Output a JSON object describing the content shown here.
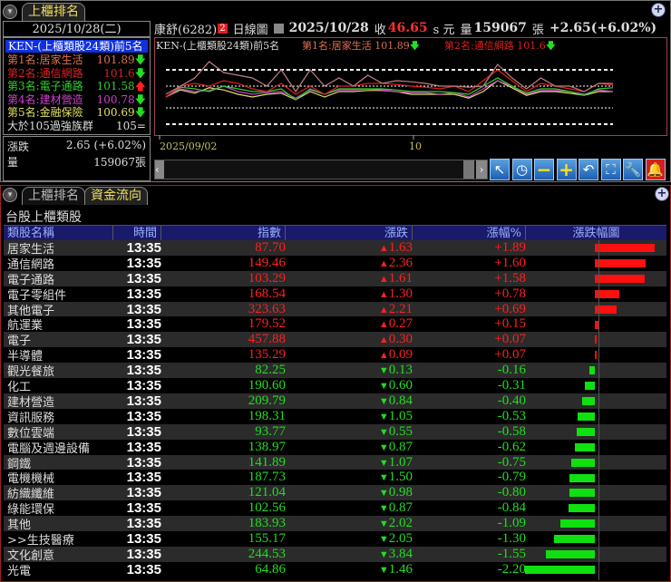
{
  "top": {
    "tab_label": "上櫃排名",
    "date": "2025/10/28(二)",
    "ranking_title": "KEN-(上櫃類股24類)前5名",
    "ranks": [
      {
        "label": "第1名:居家生活",
        "value": "101.89",
        "dir": "down",
        "color": "#e07050"
      },
      {
        "label": "第2名:通信網路",
        "value": "101.6",
        "dir": "down",
        "color": "#e02020"
      },
      {
        "label": "第3名:電子通路",
        "value": "101.58",
        "dir": "up",
        "color": "#30d030"
      },
      {
        "label": "第4名:建材營造",
        "value": "100.78",
        "dir": "down",
        "color": "#d040d0"
      },
      {
        "label": "第5名:金融保險",
        "value": "100.69",
        "dir": "down",
        "color": "#e0e060"
      },
      {
        "label": "大於105過強族群",
        "value": "105=",
        "dir": "",
        "color": "#dddddd"
      }
    ],
    "change_label": "漲跌",
    "change_value": "2.65 (+6.02%)",
    "volume_label": "量",
    "volume_value": "159067張",
    "stock": "康舒(6282)",
    "badge": "2",
    "chart_type": "日線圖",
    "quote_date": "2025/10/28",
    "close_label": "收",
    "close_value": "46.65",
    "close_unit": "s 元",
    "vol_label": "量",
    "vol_value": "159067",
    "vol_unit": "張",
    "chg": "+2.65(+6.02%)",
    "chart_title": "KEN-(上櫃類股24類)前5名",
    "legend1": "第1名:居家生活 101.89",
    "legend2": "第2名:通信網路 101.6",
    "x_start": "2025/09/02",
    "x_mid": "10"
  },
  "chart_data": {
    "type": "line",
    "title": "KEN-(上櫃類股24類)前5名",
    "reference_levels": [
      104,
      101,
      97,
      94
    ],
    "series": [
      {
        "name": "居家生活",
        "color": "#c08080",
        "values": [
          99.5,
          101,
          102.5,
          105.5,
          103.5,
          103,
          102.5,
          101,
          104,
          100,
          104,
          101,
          102.5,
          101,
          103,
          101.5,
          102,
          101.8,
          101.5,
          101,
          101,
          100.8,
          101,
          105,
          102.5,
          100.5,
          102.5,
          101,
          101,
          100,
          101.5,
          101.5
        ]
      },
      {
        "name": "通信網路",
        "color": "#e02020",
        "values": [
          99,
          101,
          101.5,
          101,
          102,
          101.5,
          100.5,
          100,
          101.5,
          99.5,
          101,
          99.5,
          101,
          101,
          101.5,
          101.5,
          101.3,
          101,
          100.8,
          100.5,
          101,
          100,
          102,
          104,
          102,
          100,
          101.5,
          101,
          100.5,
          100,
          101.5,
          101.2
        ]
      },
      {
        "name": "電子通路",
        "color": "#30d030",
        "values": [
          99,
          100.8,
          100.5,
          100,
          101,
          100.5,
          100,
          100,
          100.5,
          98.5,
          100.5,
          99.5,
          100.5,
          100.5,
          100.5,
          100.5,
          100.3,
          100,
          100,
          100,
          99.8,
          99.5,
          101,
          102.5,
          101,
          99.7,
          100.5,
          100.5,
          100,
          99.3,
          100.5,
          100.7
        ]
      },
      {
        "name": "建材營造",
        "color": "#d040d0",
        "values": [
          99,
          100.5,
          100,
          100.2,
          101,
          100,
          99.5,
          99.8,
          100,
          98.8,
          100.3,
          99.5,
          100.3,
          100.3,
          100.5,
          100.3,
          100,
          99.8,
          99.8,
          99.5,
          99.8,
          99,
          100.5,
          102,
          101,
          99.5,
          100.2,
          100.2,
          100,
          99.5,
          100.3,
          100
        ]
      },
      {
        "name": "金融保險",
        "color": "#e0e060",
        "values": [
          99,
          100.3,
          99.7,
          100.7,
          100.3,
          99.5,
          99,
          99.5,
          99.7,
          98.5,
          100,
          99,
          100,
          100,
          100.2,
          100.2,
          100,
          99.5,
          99.5,
          99.5,
          99.5,
          98.8,
          100,
          102,
          100.7,
          99.3,
          100,
          100,
          99.7,
          99.3,
          100,
          100
        ]
      }
    ]
  },
  "toolbar": [
    "arrow-up-left",
    "clock",
    "minus",
    "plus",
    "undo",
    "fit",
    "wrench",
    "bell"
  ],
  "bottom": {
    "tabs": [
      "上櫃排名",
      "資金流向"
    ],
    "title": "台股上櫃類股",
    "headers": [
      "類股名稱",
      "時間",
      "指數",
      "漲跌",
      "漲幅%",
      "漲跌幅圖"
    ],
    "rows": [
      {
        "name": "居家生活",
        "time": "13:35",
        "index": "87.70",
        "chg": "1.63",
        "pct": "+1.89",
        "p": 1.89
      },
      {
        "name": "通信網路",
        "time": "13:35",
        "index": "149.46",
        "chg": "2.36",
        "pct": "+1.60",
        "p": 1.6
      },
      {
        "name": "電子通路",
        "time": "13:35",
        "index": "103.29",
        "chg": "1.61",
        "pct": "+1.58",
        "p": 1.58
      },
      {
        "name": "電子零組件",
        "time": "13:35",
        "index": "168.54",
        "chg": "1.30",
        "pct": "+0.78",
        "p": 0.78
      },
      {
        "name": "其他電子",
        "time": "13:35",
        "index": "323.63",
        "chg": "2.21",
        "pct": "+0.69",
        "p": 0.69
      },
      {
        "name": "航運業",
        "time": "13:35",
        "index": "179.52",
        "chg": "0.27",
        "pct": "+0.15",
        "p": 0.15
      },
      {
        "name": "電子",
        "time": "13:35",
        "index": "457.88",
        "chg": "0.30",
        "pct": "+0.07",
        "p": 0.07
      },
      {
        "name": "半導體",
        "time": "13:35",
        "index": "135.29",
        "chg": "0.09",
        "pct": "+0.07",
        "p": 0.07
      },
      {
        "name": "觀光餐旅",
        "time": "13:35",
        "index": "82.25",
        "chg": "0.13",
        "pct": "-0.16",
        "p": -0.16
      },
      {
        "name": "化工",
        "time": "13:35",
        "index": "190.60",
        "chg": "0.60",
        "pct": "-0.31",
        "p": -0.31
      },
      {
        "name": "建材營造",
        "time": "13:35",
        "index": "209.79",
        "chg": "0.84",
        "pct": "-0.40",
        "p": -0.4
      },
      {
        "name": "資訊服務",
        "time": "13:35",
        "index": "198.31",
        "chg": "1.05",
        "pct": "-0.53",
        "p": -0.53
      },
      {
        "name": "數位雲端",
        "time": "13:35",
        "index": "93.77",
        "chg": "0.55",
        "pct": "-0.58",
        "p": -0.58
      },
      {
        "name": "電腦及週邊設備",
        "time": "13:35",
        "index": "138.97",
        "chg": "0.87",
        "pct": "-0.62",
        "p": -0.62
      },
      {
        "name": "鋼鐵",
        "time": "13:35",
        "index": "141.89",
        "chg": "1.07",
        "pct": "-0.75",
        "p": -0.75
      },
      {
        "name": "電機機械",
        "time": "13:35",
        "index": "187.73",
        "chg": "1.50",
        "pct": "-0.79",
        "p": -0.79
      },
      {
        "name": "紡織纖維",
        "time": "13:35",
        "index": "121.04",
        "chg": "0.98",
        "pct": "-0.80",
        "p": -0.8
      },
      {
        "name": "綠能環保",
        "time": "13:35",
        "index": "102.56",
        "chg": "0.87",
        "pct": "-0.84",
        "p": -0.84
      },
      {
        "name": "其他",
        "time": "13:35",
        "index": "183.93",
        "chg": "2.02",
        "pct": "-1.09",
        "p": -1.09
      },
      {
        "name": ">>生技醫療",
        "time": "13:35",
        "index": "155.17",
        "chg": "2.05",
        "pct": "-1.30",
        "p": -1.3
      },
      {
        "name": "文化創意",
        "time": "13:35",
        "index": "244.53",
        "chg": "3.84",
        "pct": "-1.55",
        "p": -1.55
      },
      {
        "name": "光電",
        "time": "13:35",
        "index": "64.86",
        "chg": "1.46",
        "pct": "-2.20",
        "p": -2.2
      }
    ]
  }
}
